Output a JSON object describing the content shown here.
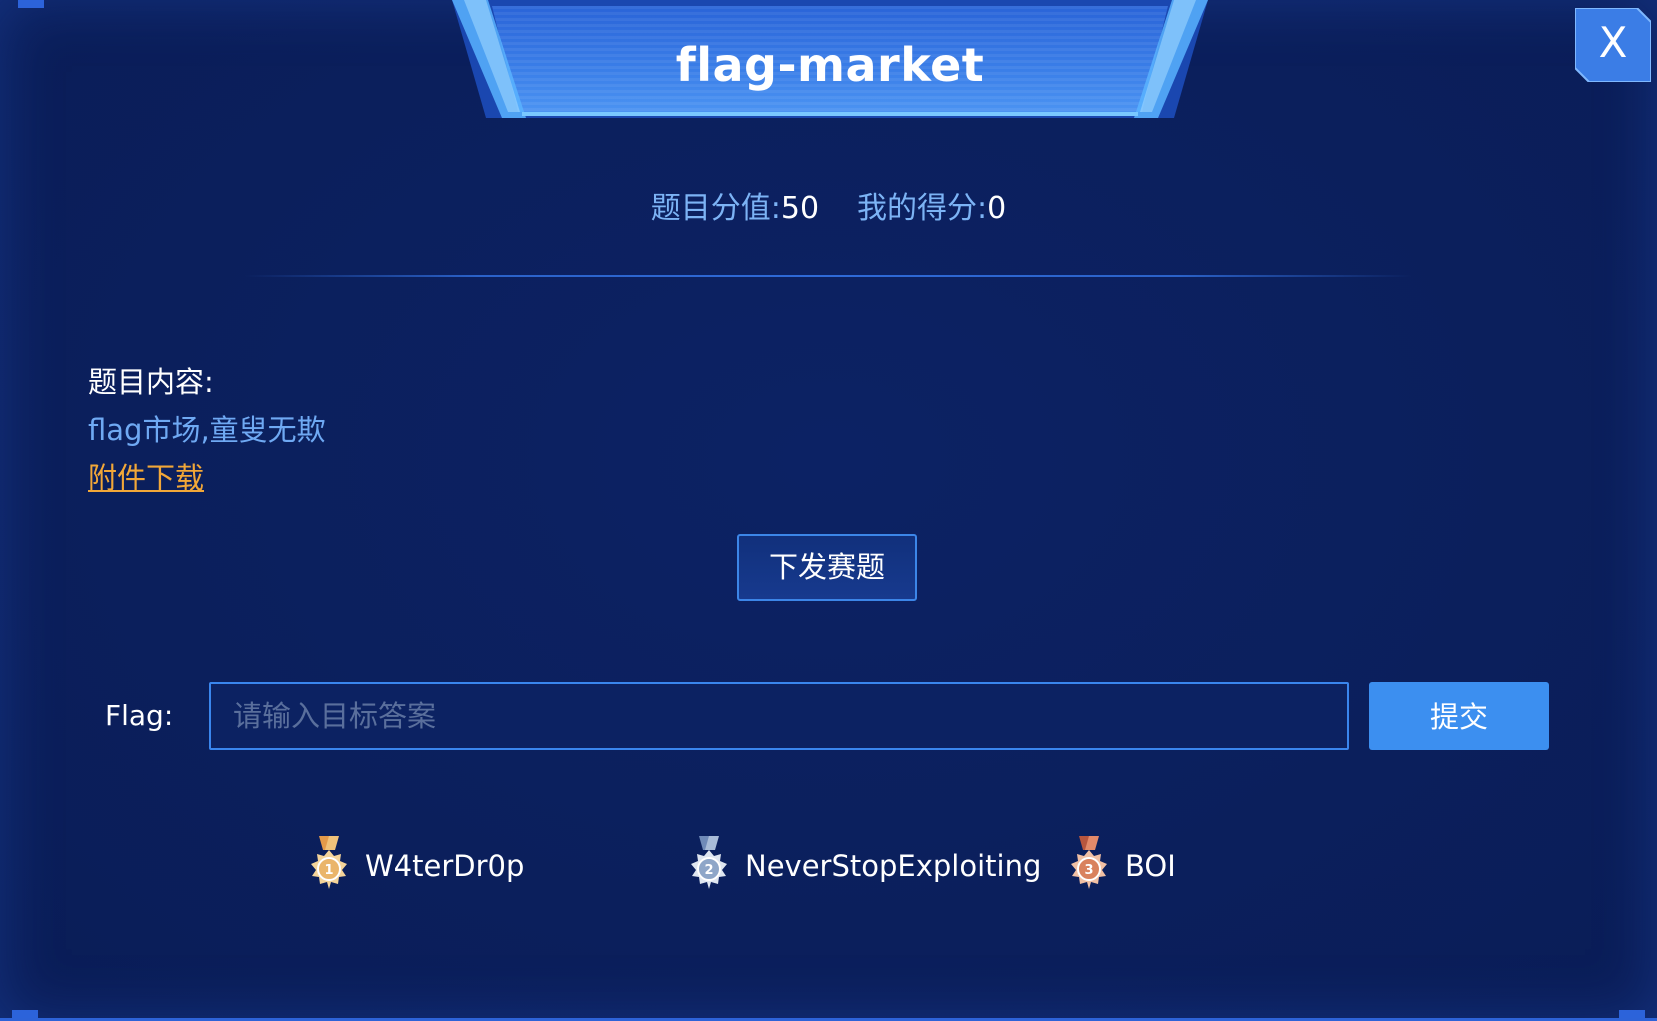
{
  "header": {
    "title": "flag-market",
    "close_label": "X"
  },
  "score": {
    "value_label": "题目分值:",
    "value": "50",
    "mine_label": "我的得分:",
    "mine": "0"
  },
  "content": {
    "heading": "题目内容:",
    "description": "flag市场,童叟无欺",
    "attachment_link": "附件下载"
  },
  "actions": {
    "issue_button": "下发赛题"
  },
  "flag_form": {
    "label": "Flag:",
    "placeholder": "请输入目标答案",
    "value": "",
    "submit_label": "提交"
  },
  "solvers": [
    {
      "rank": "1",
      "name": "W4terDr0p",
      "medal": "gold-medal-icon"
    },
    {
      "rank": "2",
      "name": "NeverStopExploiting",
      "medal": "silver-medal-icon"
    },
    {
      "rank": "3",
      "name": "BOI",
      "medal": "bronze-medal-icon"
    }
  ],
  "colors": {
    "background": "#0b1f5c",
    "accent": "#3c8ff0",
    "label_blue": "#7cb3f5",
    "link_orange": "#f2a738",
    "gold": "#e8b86a",
    "silver": "#c9d4e4",
    "bronze": "#d98c66"
  }
}
